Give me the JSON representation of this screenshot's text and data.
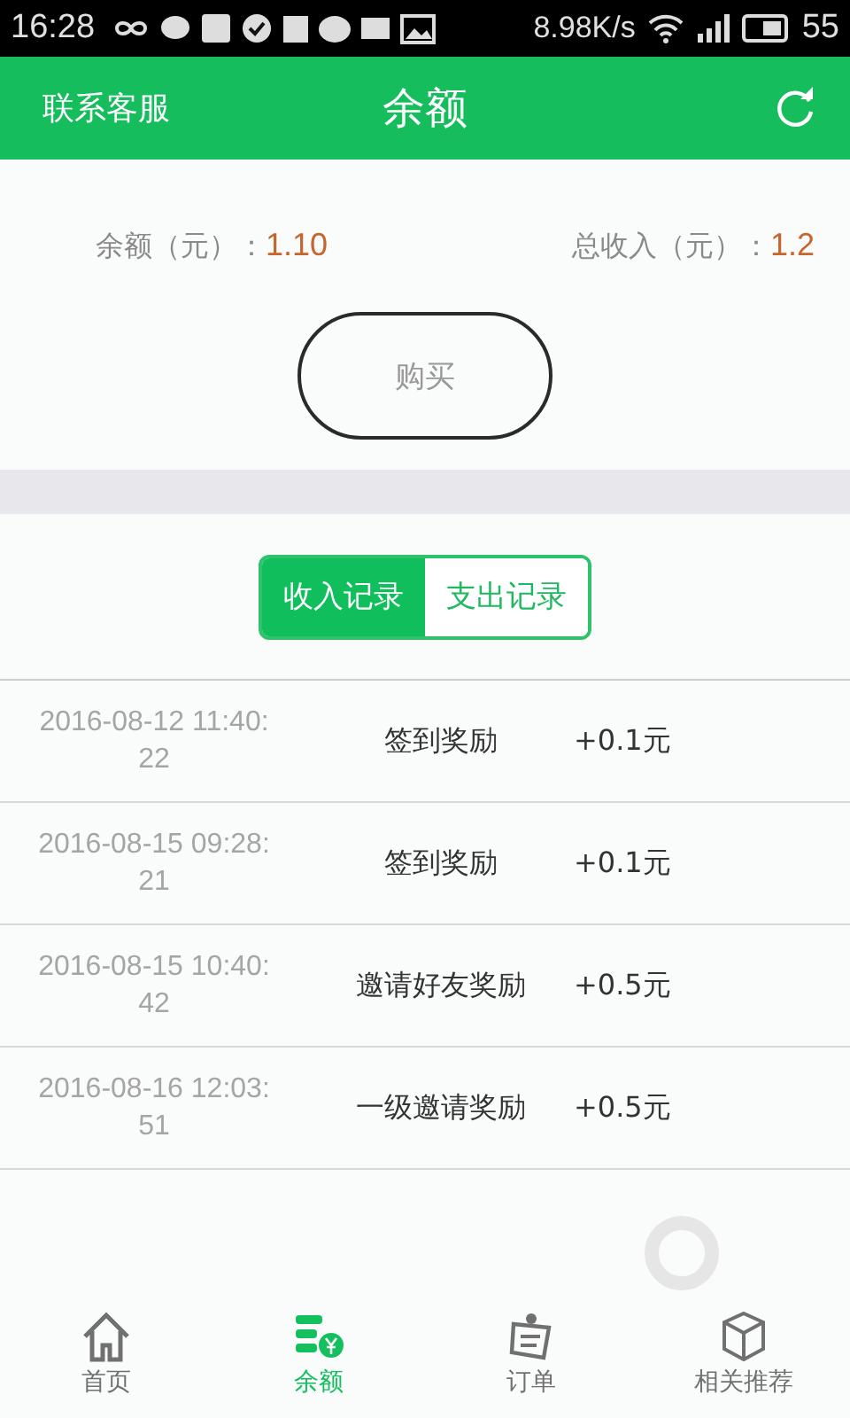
{
  "status_bar": {
    "time": "16:28",
    "speed": "8.98K/s",
    "battery": "55"
  },
  "header": {
    "left": "联系客服",
    "title": "余额"
  },
  "summary": {
    "balance_label": "余额（元）：",
    "balance": "1.10",
    "income_label": "总收入（元）：",
    "income": "1.2",
    "buy": "购买"
  },
  "tabs": [
    {
      "label": "收入记录",
      "selected": true
    },
    {
      "label": "支出记录",
      "selected": false
    }
  ],
  "records": [
    {
      "time": "2016-08-12 11:40:22",
      "event": "签到奖励",
      "amount": "+0.1元"
    },
    {
      "time": "2016-08-15 09:28:21",
      "event": "签到奖励",
      "amount": "+0.1元"
    },
    {
      "time": "2016-08-15 10:40:42",
      "event": "邀请好友奖励",
      "amount": "+0.5元"
    },
    {
      "time": "2016-08-16 12:03:51",
      "event": "一级邀请奖励",
      "amount": "+0.5元"
    }
  ],
  "nav": [
    {
      "label": "首页",
      "kind": "home",
      "selected": false
    },
    {
      "label": "余额",
      "kind": "coins",
      "selected": true
    },
    {
      "label": "订单",
      "kind": "order",
      "selected": false
    },
    {
      "label": "相关推荐",
      "kind": "box",
      "selected": false
    }
  ]
}
